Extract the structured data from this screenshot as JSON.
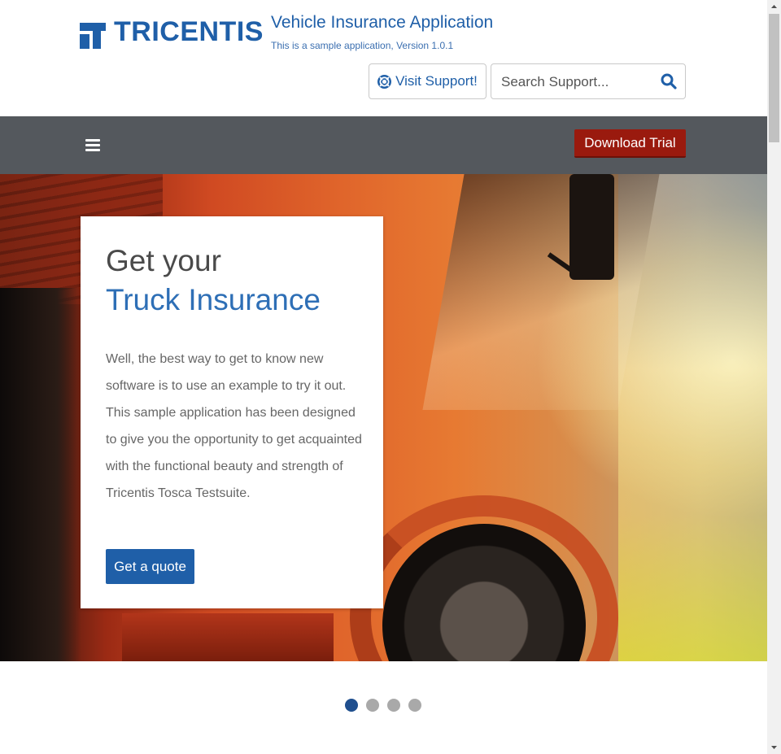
{
  "header": {
    "logo_text": "TRICENTIS",
    "app_title": "Vehicle Insurance Application",
    "app_subtitle": "This is a sample application, Version 1.0.1",
    "support_label": "Visit Support!",
    "search_placeholder": "Search Support..."
  },
  "nav": {
    "download_label": "Download Trial"
  },
  "hero": {
    "line1": "Get your",
    "line2": "Truck Insurance",
    "text": "Well, the best way to get to know new software is to use an example to try it out. This sample application has been designed to give you the opportunity to get acquainted with the functional beauty and strength of Tricentis Tosca Testsuite.",
    "cta_label": "Get a quote"
  },
  "carousel": {
    "slide_count": 4,
    "active_index": 0
  },
  "colors": {
    "brand_blue": "#1f5fa8",
    "nav_gray": "#54585d",
    "download_red": "#9a1a0e"
  }
}
